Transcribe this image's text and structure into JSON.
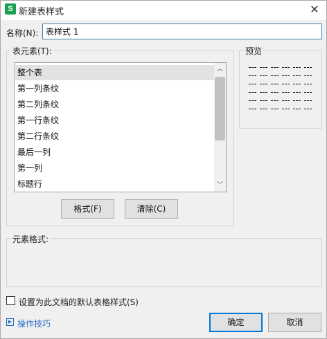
{
  "window": {
    "title": "新建表样式",
    "app_icon_letter": "S",
    "close_glyph": "✕"
  },
  "name_field": {
    "label": "名称(N):",
    "value": "表样式 1"
  },
  "table_elements": {
    "group_label": "表元素(T):",
    "items": [
      {
        "label": "整个表",
        "selected": true
      },
      {
        "label": "第一列条纹",
        "selected": false
      },
      {
        "label": "第二列条纹",
        "selected": false
      },
      {
        "label": "第一行条纹",
        "selected": false
      },
      {
        "label": "第二行条纹",
        "selected": false
      },
      {
        "label": "最后一列",
        "selected": false
      },
      {
        "label": "第一列",
        "selected": false
      },
      {
        "label": "标题行",
        "selected": false
      }
    ],
    "scroll_up_glyph": "︿",
    "scroll_down_glyph": "﹀",
    "format_button": "格式(F)",
    "clear_button": "清除(C)"
  },
  "preview": {
    "group_label": "预览"
  },
  "element_format": {
    "group_label": "元素格式:"
  },
  "default_checkbox": {
    "label": "设置为此文档的默认表格样式(S)",
    "checked": false
  },
  "footer": {
    "tips_link": "操作技巧",
    "ok_button": "确定",
    "cancel_button": "取消"
  },
  "colors": {
    "accent": "#0078d7",
    "app_icon": "#1aa053",
    "link": "#2b6cc4",
    "selected_row": "#e2e2e2"
  }
}
